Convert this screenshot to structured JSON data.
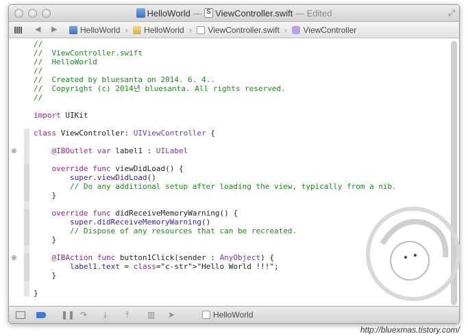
{
  "window": {
    "title_project": "HelloWorld",
    "title_separator": "—",
    "title_file": "ViewController.swift",
    "title_status": "— Edited"
  },
  "jumpbar": {
    "back_glyph": "◀",
    "forward_glyph": "▶",
    "crumbs": [
      "HelloWorld",
      "HelloWorld",
      "ViewController.swift",
      "ViewController"
    ],
    "crumb_separator": "›"
  },
  "code_lines": [
    "//",
    "//  ViewController.swift",
    "//  HelloWorld",
    "//",
    "//  Created by bluesanta on 2014. 6. 4..",
    "//  Copyright (c) 2014년 bluesanta. All rights reserved.",
    "//",
    "",
    "import UIKit",
    "",
    "class ViewController: UIViewController {",
    "",
    "    @IBOutlet var label1 : UILabel",
    "",
    "    override func viewDidLoad() {",
    "        super.viewDidLoad()",
    "        // Do any additional setup after loading the view, typically from a nib.",
    "    }",
    "",
    "    override func didReceiveMemoryWarning() {",
    "        super.didReceiveMemoryWarning()",
    "        // Dispose of any resources that can be recreated.",
    "    }",
    "",
    "    @IBAction func button1Click(sender : AnyObject) {",
    "        label1.text = \"Hello World !!!\";",
    "    }",
    "",
    "}"
  ],
  "statusbar": {
    "target_label": "HelloWorld"
  },
  "credit": "http://bluexmas.tistory.com/"
}
